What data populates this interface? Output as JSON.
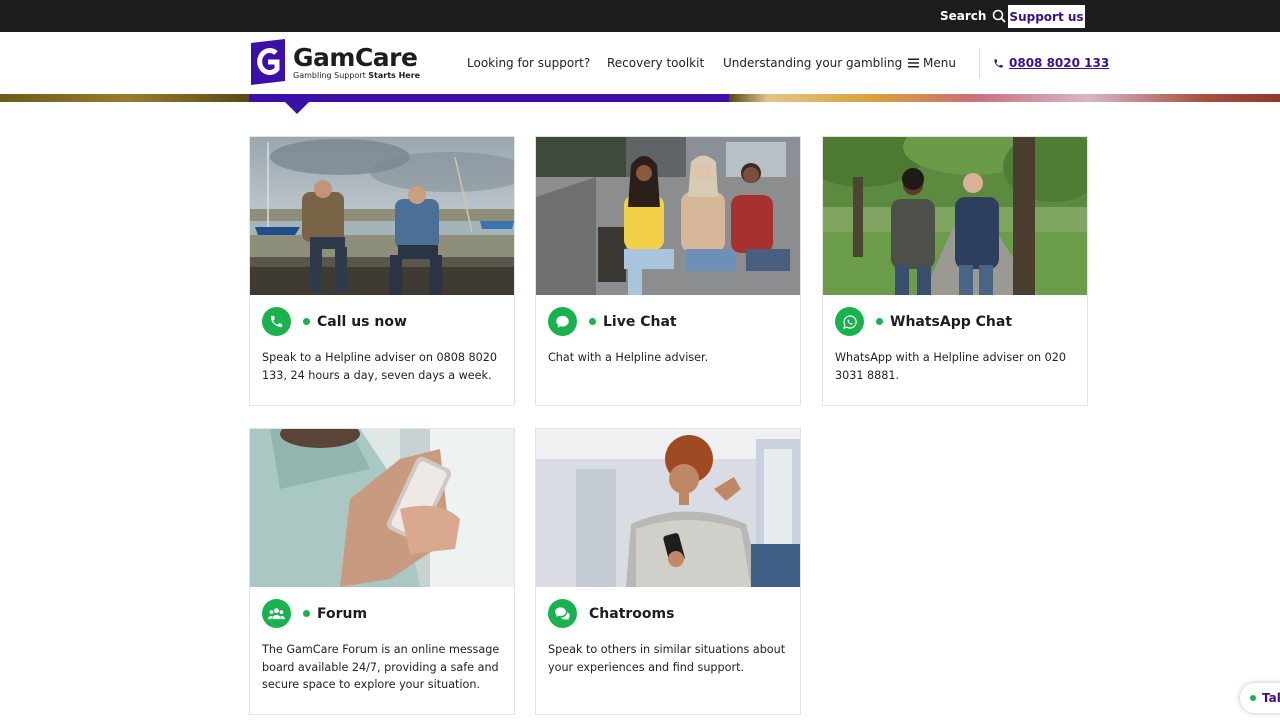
{
  "topbar": {
    "search_label": "Search",
    "support_label": "Support us"
  },
  "header": {
    "logo_name": "GamCare",
    "logo_tagline_plain": "Gambling Support ",
    "logo_tagline_bold": "Starts Here",
    "nav": [
      {
        "label": "Looking for support?"
      },
      {
        "label": "Recovery toolkit"
      },
      {
        "label": "Understanding your gambling"
      },
      {
        "label": "Menu",
        "icon": "hamburger-icon"
      }
    ],
    "phone": "0808 8020 133"
  },
  "cards": [
    {
      "title": "Call us now",
      "icon": "phone-icon",
      "status_dot": true,
      "text": "Speak to a Helpline adviser on 0808 8020 133, 24 hours a day, seven days a week."
    },
    {
      "title": "Live Chat",
      "icon": "chat-bubble-icon",
      "status_dot": true,
      "text": "Chat with a Helpline adviser."
    },
    {
      "title": "WhatsApp Chat",
      "icon": "whatsapp-icon",
      "status_dot": true,
      "text": "WhatsApp with a Helpline adviser on 020 3031 8881."
    },
    {
      "title": "Forum",
      "icon": "users-icon",
      "status_dot": true,
      "text": "The GamCare Forum is an online message board available 24/7, providing a safe and secure space to explore your situation."
    },
    {
      "title": "Chatrooms",
      "icon": "chatrooms-icon",
      "status_dot": false,
      "text": "Speak to others in similar situations about your experiences and find support."
    }
  ],
  "talk_widget": {
    "label": "Tal"
  },
  "colors": {
    "brand_purple": "#3b0fa8",
    "status_green": "#19b24f",
    "topbar": "#1d1d1d"
  }
}
